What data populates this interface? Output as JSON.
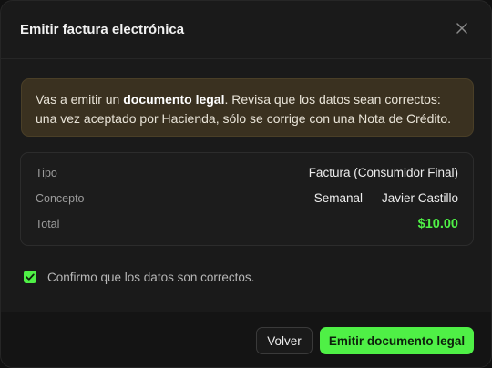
{
  "dialog": {
    "title": "Emitir factura electrónica",
    "close_icon": "close-icon"
  },
  "notice": {
    "prefix": "Vas a emitir un ",
    "bold": "documento legal",
    "suffix": ". Revisa que los datos sean correctos: una vez aceptado por Hacienda, sólo se corrige con una Nota de Crédito."
  },
  "summary": {
    "rows": [
      {
        "label": "Tipo",
        "value": "Factura (Consumidor Final)"
      },
      {
        "label": "Concepto",
        "value": "Semanal — Javier Castillo"
      },
      {
        "label": "Total",
        "value": "$10.00"
      }
    ]
  },
  "confirm": {
    "label": "Confirmo que los datos son correctos.",
    "checked": true
  },
  "footer": {
    "back_label": "Volver",
    "emit_label": "Emitir documento legal"
  },
  "colors": {
    "accent": "#4ff046",
    "notice_bg": "#3a3120",
    "surface": "#1a1a1a"
  }
}
